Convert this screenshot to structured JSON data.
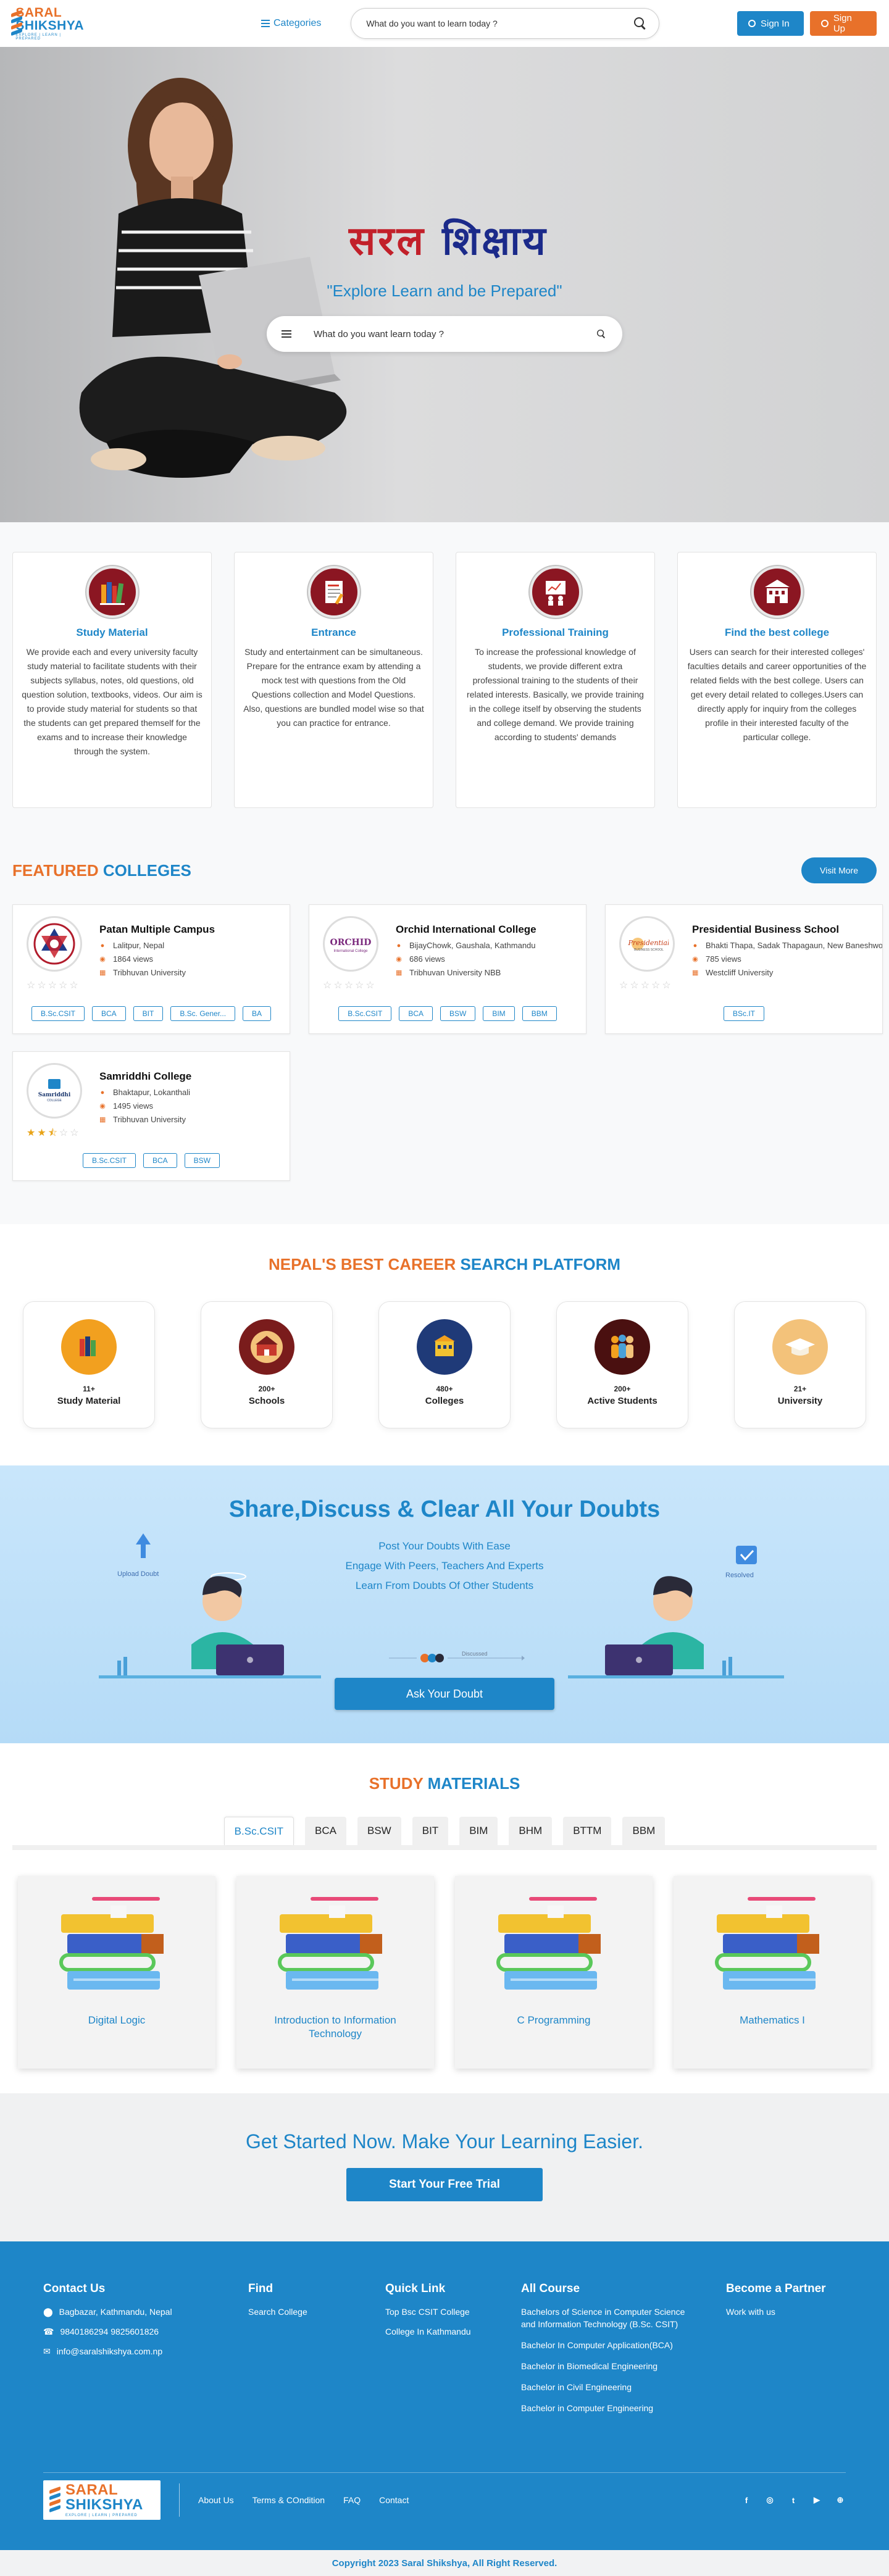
{
  "header": {
    "logo_line1": "SARAL",
    "logo_line2": "SHIKSHYA",
    "logo_tagline": "EXPLORE | LEARN | PREPARED",
    "categories_label": "Categories",
    "search_placeholder": "What do you want to learn today ?",
    "signin_label": "Sign In",
    "signup_label": "Sign Up"
  },
  "hero": {
    "title_part1": "सरल",
    "title_part2": "शिक्षाय",
    "subtitle": "\"Explore Learn and be Prepared\"",
    "search_placeholder": "What do you want learn today ?"
  },
  "features": [
    {
      "title": "Study Material",
      "text": "We provide each and every university faculty study material to facilitate students with their subjects syllabus, notes, old questions, old question solution, textbooks, videos. Our aim is to provide study material for students so that the students can get prepared themself for the exams and to increase their knowledge through the system.",
      "icon": "books-icon"
    },
    {
      "title": "Entrance",
      "text": "Study and entertainment can be simultaneous. Prepare for the entrance exam by attending a mock test with questions from the Old Questions collection and Model Questions. Also, questions are bundled model wise so that you can practice for entrance.",
      "icon": "exam-icon"
    },
    {
      "title": "Professional Training",
      "text": "To increase the professional knowledge of students, we provide different extra professional training to the students of their related interests. Basically, we provide training in the college itself by observing the students and college demand. We provide training according to students' demands",
      "icon": "training-icon"
    },
    {
      "title": "Find the best college",
      "text": "Users can search for their interested colleges' faculties details and career opportunities of the related fields with the best college. Users can get every detail related to colleges.Users can directly apply for inquiry from the colleges profile in their interested faculty of the particular college.",
      "icon": "college-icon"
    }
  ],
  "featured": {
    "title_orange": "FEATURED",
    "title_blue": "COLLEGES",
    "visit_label": "Visit More",
    "colleges": [
      {
        "name": "Patan Multiple Campus",
        "location": "Lalitpur, Nepal",
        "views": "1864 views",
        "university": "Tribhuvan University",
        "rating": 0,
        "tags": [
          "B.Sc.CSIT",
          "BCA",
          "BIT",
          "B.Sc. Gener...",
          "BA"
        ]
      },
      {
        "name": "Orchid International College",
        "location": "BijayChowk, Gaushala, Kathmandu",
        "views": "686 views",
        "university": "Tribhuvan University NBB",
        "rating": 0,
        "tags": [
          "B.Sc.CSIT",
          "BCA",
          "BSW",
          "BIM",
          "BBM"
        ]
      },
      {
        "name": "Presidential Business School",
        "location": "Bhakti Thapa, Sadak Thapagaun, New Baneshwor",
        "views": "785 views",
        "university": "Westcliff University",
        "rating": 0,
        "tags": [
          "BSc.IT"
        ]
      },
      {
        "name": "Samriddhi College",
        "location": "Bhaktapur, Lokanthali",
        "views": "1495 views",
        "university": "Tribhuvan University",
        "rating": 2.5,
        "tags": [
          "B.Sc.CSIT",
          "BCA",
          "BSW"
        ]
      }
    ]
  },
  "career": {
    "title_orange": "NEPAL'S BEST CAREER",
    "title_blue": "SEARCH PLATFORM",
    "stats": [
      {
        "num": "11+",
        "label": "Study Material",
        "color": "#f2a01f"
      },
      {
        "num": "200+",
        "label": "Schools",
        "color": "#7a1c1c"
      },
      {
        "num": "480+",
        "label": "Colleges",
        "color": "#1f3a78"
      },
      {
        "num": "200+",
        "label": "Active Students",
        "color": "#4a1010"
      },
      {
        "num": "21+",
        "label": "University",
        "color": "#f3c27a"
      }
    ]
  },
  "doubts": {
    "title": "Share,Discuss & Clear All Your Doubts",
    "lines": [
      "Post Your Doubts With Ease",
      "Engage With Peers, Teachers And Experts",
      "Learn From Doubts Of Other Students"
    ],
    "upload_label": "Upload Doubt",
    "discuss_label": "Discussed",
    "resolved_label": "Resolved",
    "ask_label": "Ask Your Doubt"
  },
  "study": {
    "title_orange": "STUDY",
    "title_blue": "MATERIALS",
    "tabs": [
      "B.Sc.CSIT",
      "BCA",
      "BSW",
      "BIT",
      "BIM",
      "BHM",
      "BTTM",
      "BBM"
    ],
    "active_tab": 0,
    "materials": [
      "Digital Logic",
      "Introduction to Information Technology",
      "C Programming",
      "Mathematics I"
    ]
  },
  "getstarted": {
    "title": "Get Started Now. Make Your Learning Easier.",
    "button": "Start Your Free Trial"
  },
  "footer": {
    "contact_title": "Contact Us",
    "address": "Bagbazar, Kathmandu, Nepal",
    "phone": "9840186294 9825601826",
    "email": "info@saralshikshya.com.np",
    "find_title": "Find",
    "find_items": [
      "Search College"
    ],
    "quick_title": "Quick Link",
    "quick_items": [
      "Top Bsc CSIT College",
      "College In Kathmandu"
    ],
    "course_title": "All Course",
    "course_items": [
      "Bachelors of Science in Computer Science and Information Technology (B.Sc. CSIT)",
      "Bachelor In Computer Application(BCA)",
      "Bachelor in Biomedical Engineering",
      "Bachelor in Civil Engineering",
      "Bachelor in Computer Engineering"
    ],
    "partner_title": "Become a Partner",
    "partner_items": [
      "Work with us"
    ],
    "links": [
      "About Us",
      "Terms & COndition",
      "FAQ",
      "Contact"
    ],
    "copyright": "Copyright 2023 Saral Shikshya, All Right Reserved."
  }
}
